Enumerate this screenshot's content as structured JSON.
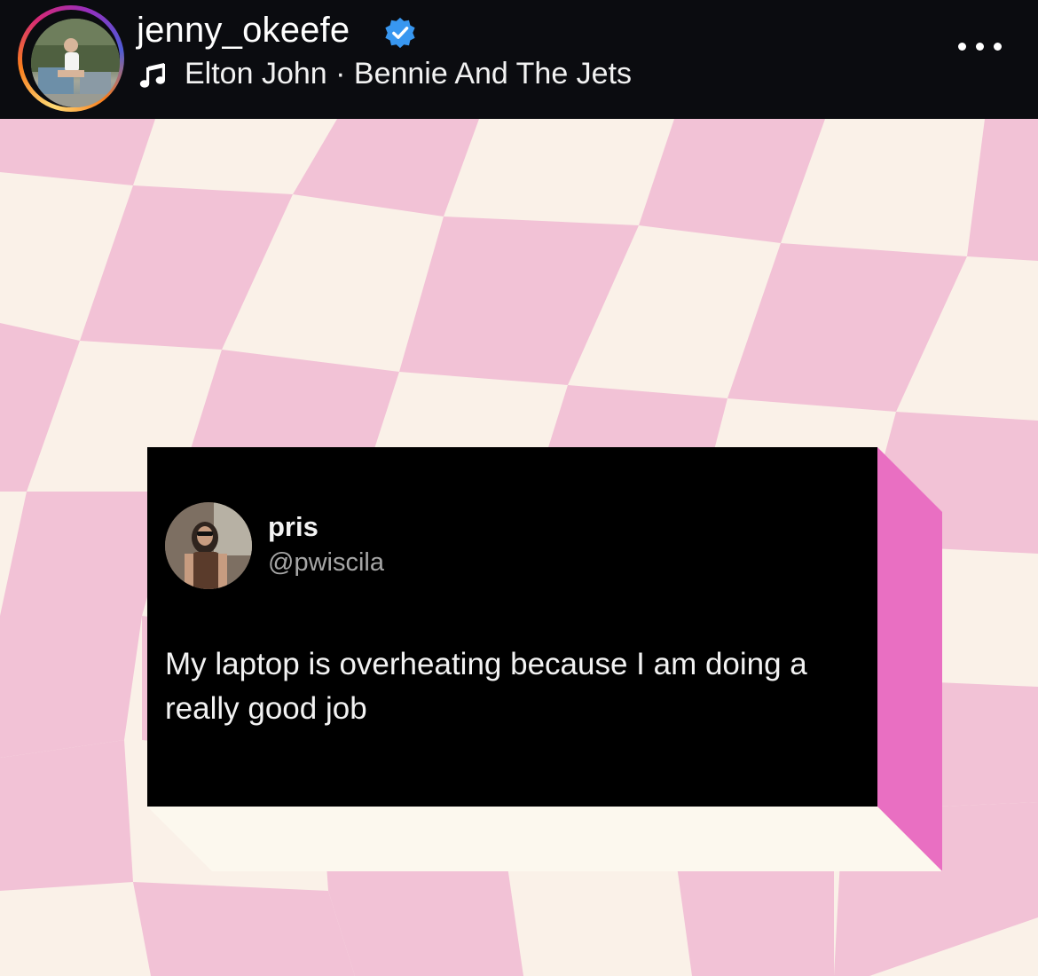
{
  "header": {
    "username": "jenny_okeefe",
    "verified": true,
    "song": "Elton John · Bennie And The Jets",
    "icons": [
      "verified-badge-icon",
      "music-note-icon",
      "more-options-icon"
    ],
    "colors": {
      "background": "#0b0c10",
      "verified": "#3897f0",
      "text": "#ffffff"
    }
  },
  "post": {
    "background_colors": {
      "pink": "#f2c2d6",
      "cream": "#faf1e8",
      "card_side": "#e96fc2",
      "card_bottom": "#fcf8ee"
    },
    "tweet": {
      "display_name": "pris",
      "handle": "@pwiscila",
      "text": "My laptop is overheating because I am doing a really good job"
    }
  }
}
